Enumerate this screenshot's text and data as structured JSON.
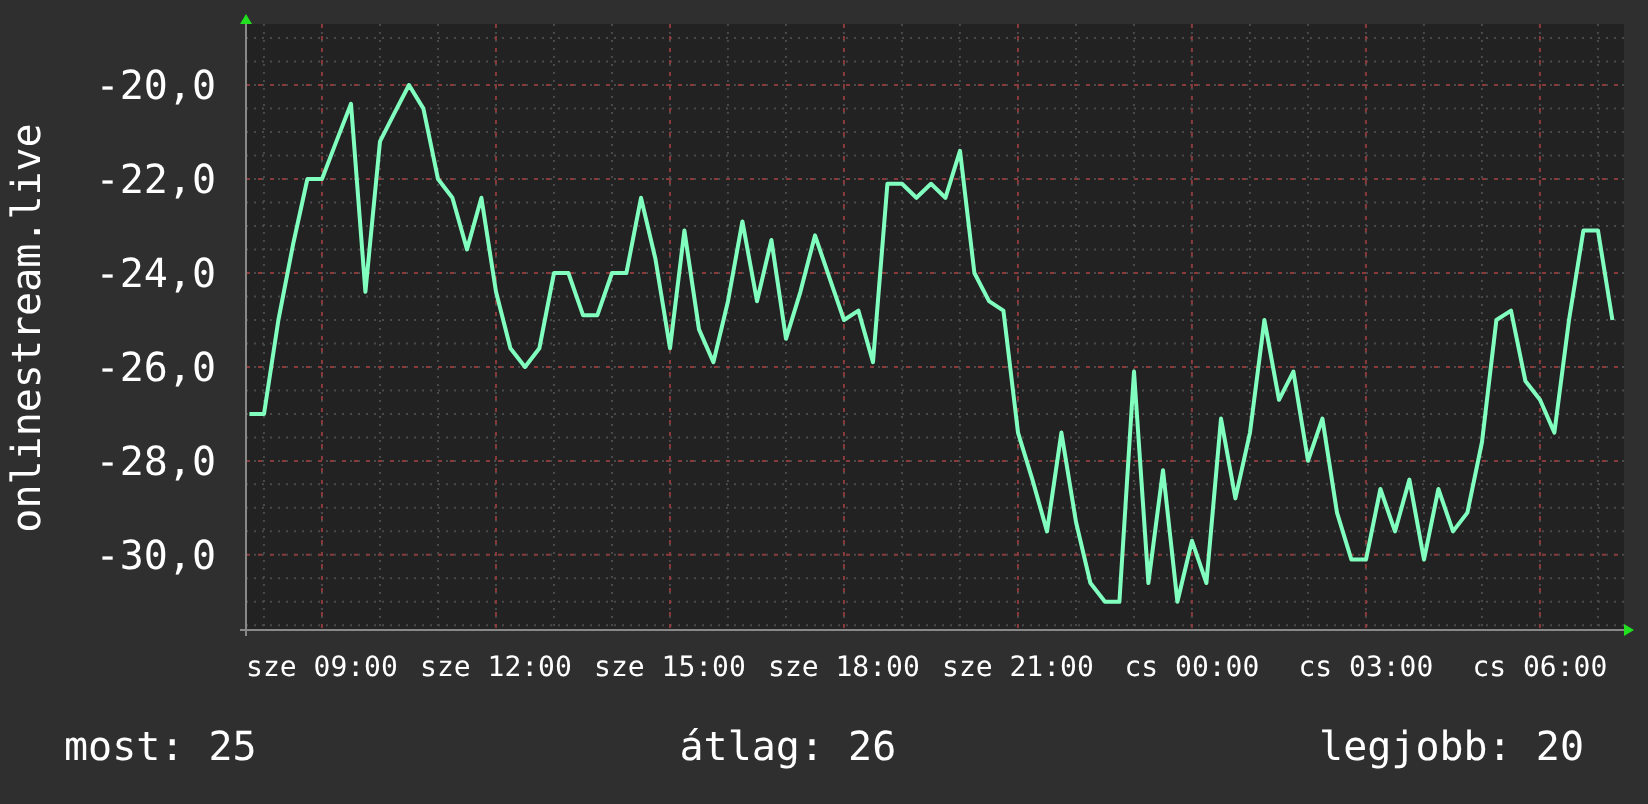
{
  "chart": {
    "chart_data": {
      "type": "line",
      "ylabel": "onlinestream.live",
      "grid": true,
      "ylim": [
        -31.6,
        -18.7
      ],
      "categories": [
        null,
        null,
        null,
        null,
        null,
        "sze 09:00",
        null,
        null,
        null,
        null,
        null,
        null,
        null,
        null,
        null,
        null,
        null,
        "sze 12:00",
        null,
        null,
        null,
        null,
        null,
        null,
        null,
        null,
        null,
        null,
        null,
        "sze 15:00",
        null,
        null,
        null,
        null,
        null,
        null,
        null,
        null,
        null,
        null,
        null,
        "sze 18:00",
        null,
        null,
        null,
        null,
        null,
        null,
        null,
        null,
        null,
        null,
        null,
        "sze 21:00",
        null,
        null,
        null,
        null,
        null,
        null,
        null,
        null,
        null,
        null,
        null,
        "cs 00:00",
        null,
        null,
        null,
        null,
        null,
        null,
        null,
        null,
        null,
        null,
        null,
        "cs 03:00",
        null,
        null,
        null,
        null,
        null,
        null,
        null,
        null,
        null,
        null,
        null,
        "cs 06:00",
        null,
        null,
        null,
        null,
        null
      ],
      "yticks": [
        {
          "value": -30,
          "label": "-30,0"
        },
        {
          "value": -28,
          "label": "-28,0"
        },
        {
          "value": -26,
          "label": "-26,0"
        },
        {
          "value": -24,
          "label": "-24,0"
        },
        {
          "value": -22,
          "label": "-22,0"
        },
        {
          "value": -20,
          "label": "-20,0"
        }
      ],
      "series": [
        {
          "color": "#80ffbf",
          "values": [
            -27.0,
            -27.0,
            -25.0,
            -23.4,
            -22.0,
            -22.0,
            -21.2,
            -20.4,
            -24.4,
            -21.2,
            -20.6,
            -20.0,
            -20.5,
            -22.0,
            -22.4,
            -23.5,
            -22.4,
            -24.4,
            -25.6,
            -26.0,
            -25.6,
            -24.0,
            -24.0,
            -24.9,
            -24.9,
            -24.0,
            -24.0,
            -22.4,
            -23.7,
            -25.6,
            -23.1,
            -25.2,
            -25.9,
            -24.6,
            -22.9,
            -24.6,
            -23.3,
            -25.4,
            -24.4,
            -23.2,
            -24.1,
            -25.0,
            -24.8,
            -25.9,
            -22.1,
            -22.1,
            -22.4,
            -22.1,
            -22.4,
            -21.4,
            -24.0,
            -24.6,
            -24.8,
            -27.4,
            -28.4,
            -29.5,
            -27.4,
            -29.3,
            -30.6,
            -31.0,
            -31.0,
            -26.1,
            -30.6,
            -28.2,
            -31.0,
            -29.7,
            -30.6,
            -27.1,
            -28.8,
            -27.4,
            -25.0,
            -26.7,
            -26.1,
            -28.0,
            -27.1,
            -29.1,
            -30.1,
            -30.1,
            -28.6,
            -29.5,
            -28.4,
            -30.1,
            -28.6,
            -29.5,
            -29.1,
            -27.6,
            -25.0,
            -24.8,
            -26.3,
            -26.7,
            -27.4,
            -25.0,
            -23.1,
            -23.1,
            -25.0
          ]
        }
      ]
    }
  },
  "legend": [
    "most: 25",
    "átlag: 26",
    "legjobb: 20"
  ]
}
